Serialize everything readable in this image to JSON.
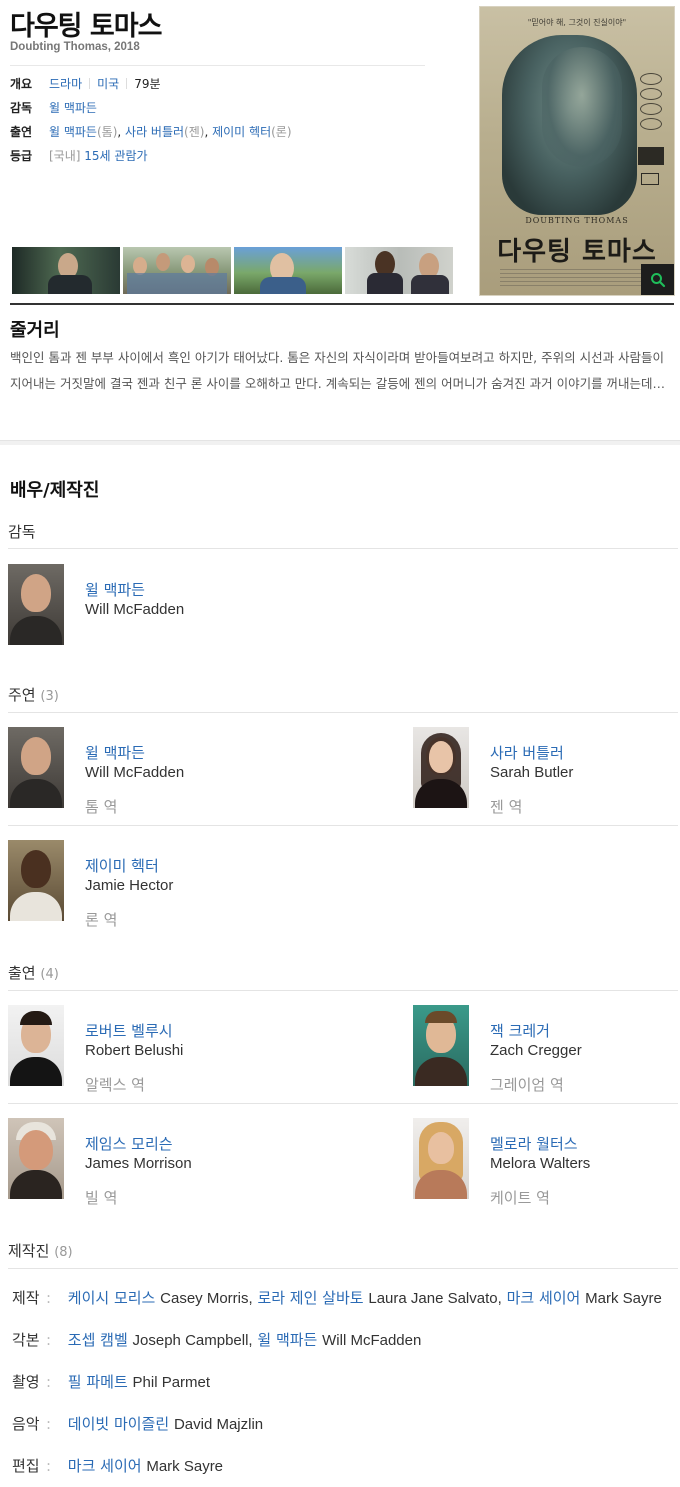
{
  "movie": {
    "title": "다우팅 토마스",
    "subtitle": "Doubting Thomas, 2018"
  },
  "info": {
    "overview": {
      "label": "개요",
      "genre": "드라마",
      "country": "미국",
      "runtime": "79분"
    },
    "director": {
      "label": "감독",
      "value": "윌 맥파든"
    },
    "cast": {
      "label": "출연",
      "p1": "윌 맥파든",
      "r1": "(톰)",
      "p2": "사라 버틀러",
      "r2": "(젠)",
      "p3": "제이미 헥터",
      "r3": "(론)"
    },
    "rating": {
      "label": "등급",
      "region": "[국내]",
      "value": "15세 관람가"
    }
  },
  "poster": {
    "tagline": "\"믿어야 해, 그것이 진실이야\"",
    "title_en": "DOUBTING THOMAS",
    "title_kr": "다우팅 토마스"
  },
  "synopsis": {
    "heading": "줄거리",
    "text": "백인인 톰과 젠 부부 사이에서 흑인 아기가 태어났다. 톰은 자신의 자식이라며 받아들여보려고 하지만, 주위의 시선과 사람들이 지어내는 거짓말에 결국 젠과 친구 론 사이를 오해하고 만다. 계속되는 갈등에 젠의 어머니가 숨겨진 과거 이야기를 꺼내는데…"
  },
  "credits": {
    "heading": "배우/제작진",
    "director_section": {
      "label": "감독"
    },
    "director": {
      "name": "윌 맥파든",
      "en": "Will McFadden"
    },
    "lead_section": {
      "label": "주연",
      "count": "(3)"
    },
    "lead": [
      {
        "name": "윌 맥파든",
        "en": "Will McFadden",
        "role": "톰 역"
      },
      {
        "name": "사라 버틀러",
        "en": "Sarah Butler",
        "role": "젠 역"
      },
      {
        "name": "제이미 헥터",
        "en": "Jamie Hector",
        "role": "론 역"
      }
    ],
    "support_section": {
      "label": "출연",
      "count": "(4)"
    },
    "support": [
      {
        "name": "로버트 벨루시",
        "en": "Robert Belushi",
        "role": "알렉스 역"
      },
      {
        "name": "잭 크레거",
        "en": "Zach Cregger",
        "role": "그레이엄 역"
      },
      {
        "name": "제임스 모리슨",
        "en": "James Morrison",
        "role": "빌 역"
      },
      {
        "name": "멜로라 월터스",
        "en": "Melora Walters",
        "role": "케이트 역"
      }
    ],
    "crew_section": {
      "label": "제작진",
      "count": "(8)"
    },
    "crew": {
      "production": {
        "label": "제작",
        "k1": "케이시 모리스",
        "e1": "Casey Morris,",
        "k2": "로라 제인 살바토",
        "e2": "Laura Jane Salvato,",
        "k3": "마크 세이어",
        "e3": "Mark Sayre"
      },
      "screenplay": {
        "label": "각본",
        "k1": "조셉 캠벨",
        "e1": "Joseph Campbell,",
        "k2": "윌 맥파든",
        "e2": "Will McFadden"
      },
      "cinematography": {
        "label": "촬영",
        "k1": "필 파메트",
        "e1": "Phil Parmet"
      },
      "music": {
        "label": "음악",
        "k1": "데이빗 마이즐린",
        "e1": "David Majzlin"
      },
      "editing": {
        "label": "편집",
        "k1": "마크 세이어",
        "e1": "Mark Sayre"
      }
    }
  }
}
